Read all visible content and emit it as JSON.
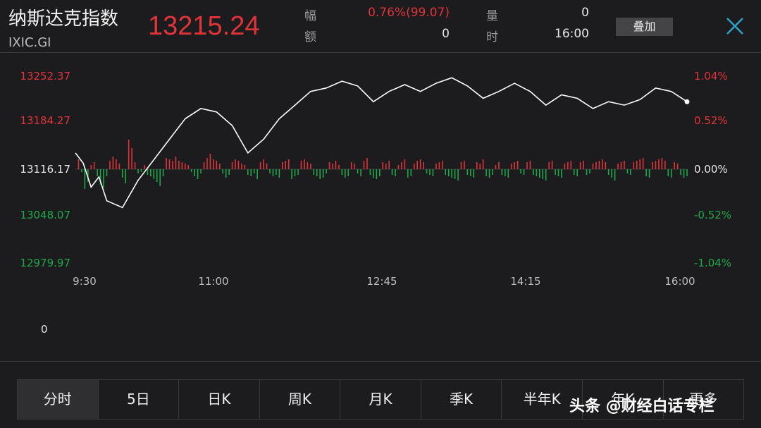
{
  "header": {
    "name": "纳斯达克指数",
    "code": "IXIC.GI",
    "price": "13215.24"
  },
  "stats": [
    {
      "label": "幅",
      "value": "0.76%(99.07)",
      "color": "#e0343a"
    },
    {
      "label": "额",
      "value": "0",
      "color": "#e6e6e6"
    },
    {
      "label": "量",
      "value": "0",
      "color": "#e6e6e6"
    },
    {
      "label": "时",
      "value": "16:00",
      "color": "#e6e6e6"
    }
  ],
  "overlay_button": "叠加",
  "close_icon": "close-icon",
  "colors": {
    "up": "#e0343a",
    "down": "#1fa84a",
    "line": "#ffffff",
    "flat": "#e6e6e6"
  },
  "chart_data": {
    "type": "line",
    "y_left": [
      "13252.37",
      "13184.27",
      "13116.17",
      "13048.07",
      "12979.97"
    ],
    "y_right": [
      "1.04%",
      "0.52%",
      "0.00%",
      "-0.52%",
      "-1.04%"
    ],
    "y_right_colors": [
      "up",
      "up",
      "flat",
      "down",
      "down"
    ],
    "x_labels": [
      "9:30",
      "11:00",
      "12:45",
      "14:15",
      "16:00"
    ],
    "ylim": [
      12979.97,
      13252.37
    ],
    "series": [
      {
        "x": [
          0,
          5,
          10,
          15,
          20,
          30,
          40,
          50,
          60,
          70,
          80,
          90,
          100,
          110,
          120,
          130,
          140,
          150,
          160,
          170,
          180,
          190,
          200,
          210,
          220,
          230,
          240,
          250,
          260,
          270,
          280,
          290,
          300,
          310,
          320,
          330,
          340,
          350,
          360,
          370,
          380,
          390
        ],
        "values": [
          13140,
          13125,
          13090,
          13105,
          13070,
          13060,
          13100,
          13130,
          13160,
          13190,
          13205,
          13200,
          13180,
          13140,
          13160,
          13190,
          13210,
          13230,
          13235,
          13245,
          13238,
          13215,
          13230,
          13240,
          13230,
          13242,
          13250,
          13238,
          13220,
          13230,
          13242,
          13230,
          13210,
          13225,
          13220,
          13205,
          13215,
          13210,
          13218,
          13235,
          13230,
          13215
        ]
      }
    ],
    "volume_label": "0",
    "net_bars": [
      [
        2,
        14
      ],
      [
        4,
        -4
      ],
      [
        6,
        -28
      ],
      [
        8,
        -18
      ],
      [
        10,
        6
      ],
      [
        12,
        10
      ],
      [
        14,
        -10
      ],
      [
        16,
        -22
      ],
      [
        18,
        -26
      ],
      [
        20,
        -10
      ],
      [
        22,
        12
      ],
      [
        24,
        18
      ],
      [
        26,
        14
      ],
      [
        28,
        8
      ],
      [
        30,
        -12
      ],
      [
        32,
        -20
      ],
      [
        34,
        42
      ],
      [
        36,
        30
      ],
      [
        38,
        10
      ],
      [
        40,
        -6
      ],
      [
        42,
        -4
      ],
      [
        44,
        6
      ],
      [
        46,
        -8
      ],
      [
        48,
        -10
      ],
      [
        50,
        -14
      ],
      [
        52,
        -18
      ],
      [
        54,
        -24
      ],
      [
        56,
        -10
      ],
      [
        58,
        16
      ],
      [
        60,
        14
      ],
      [
        62,
        12
      ],
      [
        64,
        18
      ],
      [
        66,
        12
      ],
      [
        68,
        10
      ],
      [
        70,
        8
      ],
      [
        72,
        6
      ],
      [
        74,
        -4
      ],
      [
        76,
        -10
      ],
      [
        78,
        -14
      ],
      [
        80,
        -6
      ],
      [
        82,
        10
      ],
      [
        84,
        16
      ],
      [
        86,
        22
      ],
      [
        88,
        14
      ],
      [
        90,
        12
      ],
      [
        92,
        8
      ],
      [
        94,
        -6
      ],
      [
        96,
        -12
      ],
      [
        98,
        -8
      ],
      [
        100,
        10
      ],
      [
        102,
        14
      ],
      [
        104,
        12
      ],
      [
        106,
        8
      ],
      [
        108,
        6
      ],
      [
        110,
        -8
      ],
      [
        112,
        -10
      ],
      [
        114,
        -6
      ],
      [
        116,
        -14
      ],
      [
        118,
        10
      ],
      [
        120,
        14
      ],
      [
        122,
        8
      ],
      [
        124,
        -6
      ],
      [
        126,
        -10
      ],
      [
        128,
        -8
      ],
      [
        130,
        -12
      ],
      [
        132,
        10
      ],
      [
        134,
        12
      ],
      [
        136,
        14
      ],
      [
        138,
        -14
      ],
      [
        140,
        -10
      ],
      [
        142,
        -8
      ],
      [
        144,
        12
      ],
      [
        146,
        14
      ],
      [
        148,
        10
      ],
      [
        150,
        8
      ],
      [
        152,
        -8
      ],
      [
        154,
        -10
      ],
      [
        156,
        -14
      ],
      [
        158,
        -12
      ],
      [
        160,
        -6
      ],
      [
        162,
        10
      ],
      [
        164,
        8
      ],
      [
        166,
        12
      ],
      [
        168,
        6
      ],
      [
        170,
        -8
      ],
      [
        172,
        -12
      ],
      [
        174,
        -10
      ],
      [
        176,
        10
      ],
      [
        178,
        8
      ],
      [
        180,
        -6
      ],
      [
        182,
        -10
      ],
      [
        184,
        12
      ],
      [
        186,
        16
      ],
      [
        188,
        -8
      ],
      [
        190,
        -12
      ],
      [
        192,
        -14
      ],
      [
        194,
        -10
      ],
      [
        196,
        10
      ],
      [
        198,
        8
      ],
      [
        200,
        12
      ],
      [
        202,
        -8
      ],
      [
        204,
        -10
      ],
      [
        206,
        6
      ],
      [
        208,
        10
      ],
      [
        210,
        14
      ],
      [
        212,
        -12
      ],
      [
        214,
        -10
      ],
      [
        216,
        8
      ],
      [
        218,
        12
      ],
      [
        220,
        14
      ],
      [
        222,
        10
      ],
      [
        224,
        -6
      ],
      [
        226,
        -8
      ],
      [
        228,
        -10
      ],
      [
        230,
        8
      ],
      [
        232,
        10
      ],
      [
        234,
        12
      ],
      [
        236,
        -8
      ],
      [
        238,
        -10
      ],
      [
        240,
        -12
      ],
      [
        242,
        -14
      ],
      [
        244,
        -16
      ],
      [
        246,
        10
      ],
      [
        248,
        12
      ],
      [
        250,
        -8
      ],
      [
        252,
        -10
      ],
      [
        254,
        -12
      ],
      [
        256,
        10
      ],
      [
        258,
        8
      ],
      [
        260,
        14
      ],
      [
        262,
        -10
      ],
      [
        264,
        -12
      ],
      [
        266,
        -8
      ],
      [
        268,
        6
      ],
      [
        270,
        10
      ],
      [
        272,
        -8
      ],
      [
        274,
        -10
      ],
      [
        276,
        -12
      ],
      [
        278,
        8
      ],
      [
        280,
        10
      ],
      [
        282,
        12
      ],
      [
        284,
        -6
      ],
      [
        286,
        -8
      ],
      [
        288,
        10
      ],
      [
        290,
        12
      ],
      [
        292,
        -8
      ],
      [
        294,
        -10
      ],
      [
        296,
        -12
      ],
      [
        298,
        -14
      ],
      [
        300,
        -16
      ],
      [
        302,
        10
      ],
      [
        304,
        12
      ],
      [
        306,
        -8
      ],
      [
        308,
        -10
      ],
      [
        310,
        -12
      ],
      [
        312,
        8
      ],
      [
        314,
        10
      ],
      [
        316,
        12
      ],
      [
        318,
        -8
      ],
      [
        320,
        -10
      ],
      [
        322,
        10
      ],
      [
        324,
        12
      ],
      [
        326,
        -8
      ],
      [
        328,
        -6
      ],
      [
        330,
        8
      ],
      [
        332,
        10
      ],
      [
        334,
        12
      ],
      [
        336,
        14
      ],
      [
        338,
        10
      ],
      [
        340,
        -8
      ],
      [
        342,
        -12
      ],
      [
        344,
        -16
      ],
      [
        346,
        8
      ],
      [
        348,
        10
      ],
      [
        350,
        12
      ],
      [
        352,
        -6
      ],
      [
        354,
        -8
      ],
      [
        356,
        10
      ],
      [
        358,
        12
      ],
      [
        360,
        14
      ],
      [
        362,
        16
      ],
      [
        364,
        -10
      ],
      [
        366,
        -12
      ],
      [
        368,
        10
      ],
      [
        370,
        12
      ],
      [
        372,
        14
      ],
      [
        374,
        16
      ],
      [
        376,
        12
      ],
      [
        378,
        -10
      ],
      [
        380,
        -12
      ],
      [
        382,
        10
      ],
      [
        384,
        8
      ],
      [
        386,
        -8
      ],
      [
        388,
        -12
      ],
      [
        390,
        -10
      ]
    ]
  },
  "tabs": [
    "分时",
    "5日",
    "日K",
    "周K",
    "月K",
    "季K",
    "半年K",
    "年K",
    "更多"
  ],
  "watermark": "头条 @财经白话专栏"
}
